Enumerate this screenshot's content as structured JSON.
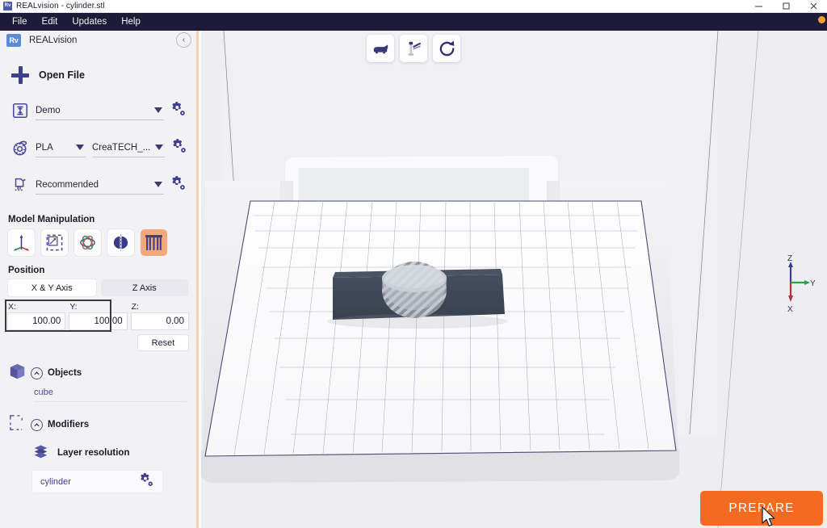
{
  "window": {
    "title": "REALvision - cylinder.stl",
    "app_badge": "Rv",
    "minimize": "minimize-icon",
    "maximize": "maximize-icon",
    "close": "close-icon"
  },
  "menubar": {
    "items": [
      {
        "label": "File"
      },
      {
        "label": "Edit"
      },
      {
        "label": "Updates"
      },
      {
        "label": "Help"
      }
    ]
  },
  "sidebar": {
    "logo_text": "Rv",
    "brand": "REALvision",
    "collapse_icon": "‹",
    "open_file": {
      "label": "Open File",
      "icon": "plus-icon"
    },
    "profile_row": {
      "icon": "printer-icon",
      "value": "Demo",
      "settings_icon": "gear-icon"
    },
    "material_row": {
      "icon": "filament-spool-icon",
      "material": "PLA",
      "nozzle": "CreaTECH_...",
      "settings_icon": "gear-icon"
    },
    "quality_row": {
      "icon": "print-quality-icon",
      "value": "Recommended",
      "settings_icon": "gear-icon"
    },
    "model_manipulation": {
      "title": "Model Manipulation",
      "tools": [
        {
          "name": "move-tool",
          "active": false
        },
        {
          "name": "scale-tool",
          "active": false
        },
        {
          "name": "rotate-tool",
          "active": false
        },
        {
          "name": "mirror-tool",
          "active": false
        },
        {
          "name": "support-tool",
          "active": true
        }
      ]
    },
    "position": {
      "title": "Position",
      "tabs": [
        {
          "label": "X & Y Axis",
          "selected": true
        },
        {
          "label": "Z Axis",
          "selected": false
        }
      ],
      "fields": [
        {
          "label": "X:",
          "value": "100.00"
        },
        {
          "label": "Y:",
          "value": "100.00"
        },
        {
          "label": "Z:",
          "value": "0.00"
        }
      ],
      "reset_label": "Reset"
    },
    "objects": {
      "title": "Objects",
      "icon": "cube-icon",
      "toggle_icon": "chevron-up-icon",
      "items": [
        {
          "label": "cube"
        }
      ]
    },
    "modifiers": {
      "title": "Modifiers",
      "icon": "modifier-box-icon",
      "toggle_icon": "chevron-up-icon",
      "items": [
        {
          "label": "Layer resolution",
          "icon": "layers-icon"
        }
      ],
      "mesh": {
        "label": "cylinder",
        "settings_icon": "gear-icon"
      }
    }
  },
  "viewport": {
    "view_tools": [
      {
        "name": "camera-view-icon"
      },
      {
        "name": "support-blocker-icon"
      },
      {
        "name": "reset-view-icon"
      }
    ],
    "axis_indicator": {
      "z_label": "Z",
      "y_label": "Y",
      "x_label": "X",
      "z_color": "#3b3b96",
      "y_color": "#2e9e4f",
      "x_color": "#b43232"
    },
    "prepare_button": {
      "label": "PREPARE",
      "color": "#f26b21"
    },
    "model": {
      "base_color": "#3e4757",
      "cylinder_color": "#b8bcc4"
    }
  },
  "colors": {
    "menubar_bg": "#1e1b38",
    "sidebar_bg": "#f2f2f5",
    "accent_orange": "#f26b21",
    "divider_peach": "#f7cfb4",
    "purple": "#3e3f8f"
  }
}
